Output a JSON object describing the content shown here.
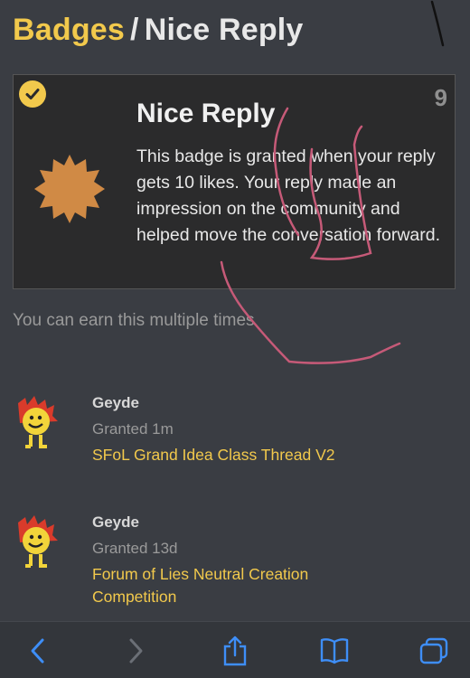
{
  "header": {
    "breadcrumb_link": "Badges",
    "separator": "/",
    "title": "Nice Reply"
  },
  "badge": {
    "title": "Nice Reply",
    "count": "9",
    "description": "This badge is granted when your reply gets 10 likes. Your reply made an impression on the community and helped move the conversation forward.",
    "icon": "bronze-badge-icon",
    "granted_check": "check-icon"
  },
  "multiple_note": "You can earn this multiple times",
  "grants": [
    {
      "user": "Geyde",
      "granted": "Granted 1m",
      "topic": "SFoL Grand Idea Class Thread V2"
    },
    {
      "user": "Geyde",
      "granted": "Granted 13d",
      "topic": "Forum of Lies Neutral Creation Competition"
    }
  ],
  "toolbar": {
    "back": "back-icon",
    "forward": "forward-icon",
    "share": "share-icon",
    "bookmarks": "bookmarks-icon",
    "tabs": "tabs-icon"
  },
  "colors": {
    "background": "#3a3d43",
    "accent": "#f2c94c",
    "card": "#2b2b2c",
    "badge_bronze": "#d08a45",
    "ios_blue": "#3e8ef7",
    "scribble": "#c65a78"
  }
}
